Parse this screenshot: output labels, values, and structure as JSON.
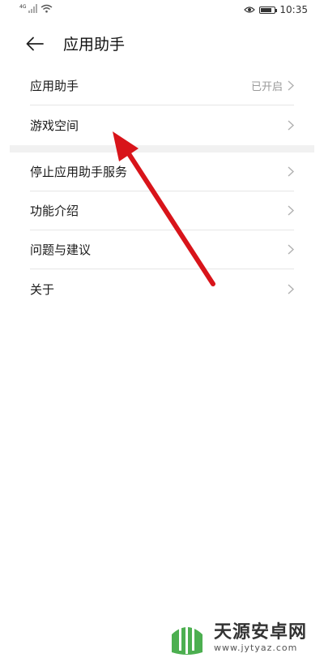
{
  "status_bar": {
    "network_label": "4G",
    "battery_level": 0.8,
    "time": "10:35"
  },
  "header": {
    "back_icon": "arrow-left-icon",
    "title": "应用助手"
  },
  "groups": [
    {
      "items": [
        {
          "label": "应用助手",
          "status": "已开启"
        },
        {
          "label": "游戏空间"
        }
      ]
    },
    {
      "items": [
        {
          "label": "停止应用助手服务"
        },
        {
          "label": "功能介绍"
        },
        {
          "label": "问题与建议"
        },
        {
          "label": "关于"
        }
      ]
    }
  ],
  "annotation": {
    "color": "#d8141a",
    "points_to": "游戏空间"
  },
  "watermark": {
    "name": "天源安卓网",
    "url": "www.jytyaz.com",
    "logo_color": "#4caf50"
  }
}
